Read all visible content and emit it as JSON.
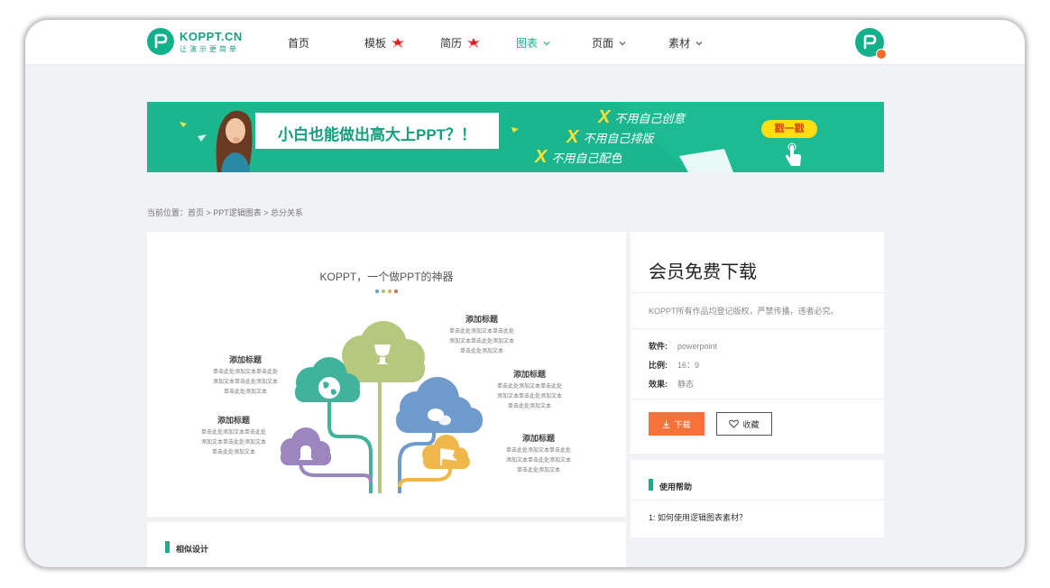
{
  "header": {
    "logo_main": "KOPPT.CN",
    "logo_sub": "让演示更简单",
    "nav": [
      {
        "label": "首页",
        "hot": false,
        "dropdown": false
      },
      {
        "label": "模板",
        "hot": true,
        "dropdown": false
      },
      {
        "label": "简历",
        "hot": true,
        "dropdown": false
      },
      {
        "label": "图表",
        "hot": false,
        "dropdown": true,
        "active": true
      },
      {
        "label": "页面",
        "hot": false,
        "dropdown": true
      },
      {
        "label": "素材",
        "hot": false,
        "dropdown": true
      }
    ],
    "hot_badge": "HOT"
  },
  "banner": {
    "headline": "小白也能做出高大上PPT？！",
    "items": [
      "不用自己创意",
      "不用自己排版",
      "不用自己配色"
    ],
    "x_mark": "X",
    "button": "戳一戳"
  },
  "breadcrumb": "当前位置：首页 > PPT逻辑图表 > 总分关系",
  "preview": {
    "title": "KOPPT，一个做PPT的神器",
    "dot_colors": [
      "#5aa7c6",
      "#a9c46b",
      "#e2b040",
      "#d06a4f"
    ],
    "annotations": [
      {
        "title": "添加标题",
        "body": [
          "单击此处添加文本单击此处",
          "添加文本单击此处添加文本",
          "单击此处添加文本"
        ]
      },
      {
        "title": "添加标题",
        "body": [
          "单击此处添加文本单击此处",
          "添加文本单击此处添加文本",
          "单击此处添加文本"
        ]
      },
      {
        "title": "添加标题",
        "body": [
          "单击此处添加文本单击此处",
          "添加文本单击此处添加文本",
          "单击此处添加文本"
        ]
      },
      {
        "title": "添加标题",
        "body": [
          "单击此处添加文本单击此处",
          "添加文本单击此处添加文本",
          "单击此处添加文本"
        ]
      },
      {
        "title": "添加标题",
        "body": [
          "单击此处添加文本单击此处",
          "添加文本单击此处添加文本",
          "单击此处添加文本"
        ]
      }
    ],
    "cloud_colors": {
      "green": "#3fb39b",
      "olive": "#b4c97e",
      "blue": "#6f9bcc",
      "purple": "#9b86bf",
      "yellow": "#f0b84a"
    }
  },
  "similar": {
    "label": "相似设计"
  },
  "panel": {
    "title": "会员免费下载",
    "notice": "KOPPT所有作品均登记版权，严禁传播，违者必究。",
    "meta": [
      {
        "key": "软件:",
        "value": "powerpoint"
      },
      {
        "key": "比例:",
        "value": "16：9"
      },
      {
        "key": "效果:",
        "value": "静态"
      }
    ],
    "download": "下载",
    "favorite": "收藏"
  },
  "help": {
    "label": "使用帮助",
    "question": "1:   如何使用逻辑图表素材？"
  },
  "colors": {
    "brand": "#12b18c",
    "download": "#f5733a"
  }
}
